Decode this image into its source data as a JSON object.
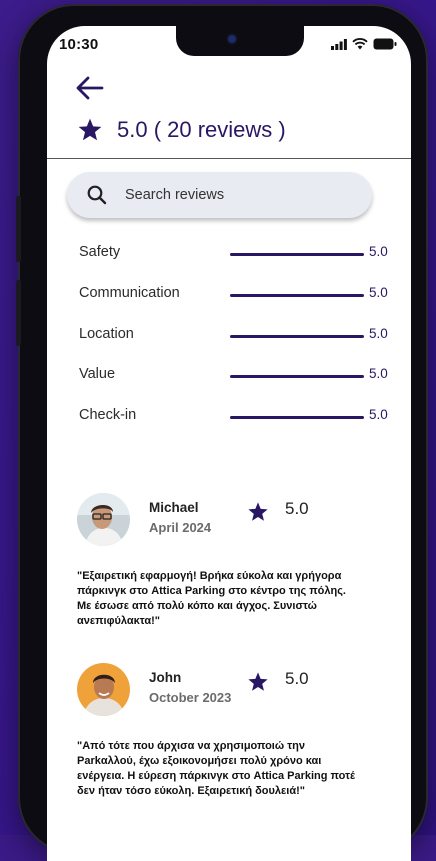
{
  "status": {
    "time": "10:30"
  },
  "header": {
    "rating_text": "5.0 ( 20 reviews )"
  },
  "search": {
    "placeholder": "Search reviews"
  },
  "metrics": [
    {
      "label": "Safety",
      "value": "5.0"
    },
    {
      "label": "Communication",
      "value": "5.0"
    },
    {
      "label": "Location",
      "value": "5.0"
    },
    {
      "label": "Value",
      "value": "5.0"
    },
    {
      "label": "Check-in",
      "value": "5.0"
    }
  ],
  "reviews": [
    {
      "name": "Michael",
      "date": "April 2024",
      "score": "5.0",
      "text": "\"Εξαιρετική εφαρμογή! Βρήκα εύκολα και γρήγορα πάρκινγκ στο Attica Parking στο κέντρο της πόλης. Με έσωσε από πολύ κόπο και άγχος. Συνιστώ ανεπιφύλακτα!\""
    },
    {
      "name": "John",
      "date": "October 2023",
      "score": "5.0",
      "text": "\"Από τότε που άρχισα να χρησιμοποιώ την Parkαλλού, έχω εξοικονομήσει πολύ χρόνο και ενέργεια. Η εύρεση πάρκινγκ στο Attica Parking ποτέ δεν ήταν τόσο εύκολη. Εξαιρετική δουλειά!\""
    }
  ],
  "colors": {
    "accent": "#2a1763",
    "background": "#3a1a86"
  },
  "icons": [
    "back-arrow-icon",
    "star-icon",
    "search-icon",
    "signal-icon",
    "wifi-icon",
    "battery-icon"
  ]
}
